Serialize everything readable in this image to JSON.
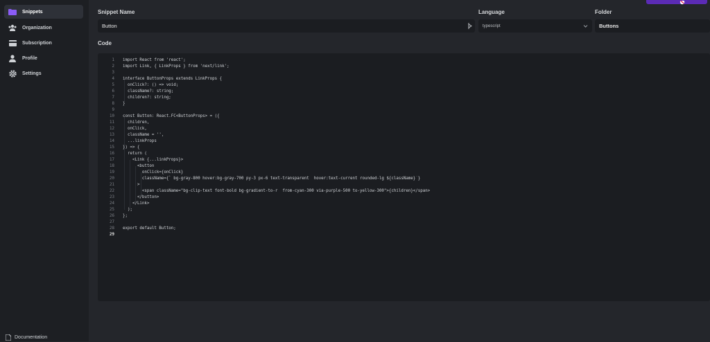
{
  "sidebar": {
    "items": [
      {
        "label": "Snippets",
        "icon": "folder-icon",
        "active": true
      },
      {
        "label": "Organization",
        "icon": "users-icon",
        "active": false
      },
      {
        "label": "Subscription",
        "icon": "credit-card-icon",
        "active": false
      },
      {
        "label": "Profile",
        "icon": "user-icon",
        "active": false
      },
      {
        "label": "Settings",
        "icon": "gear-icon",
        "active": false
      }
    ],
    "footer_link": "Documentation"
  },
  "form": {
    "snippet_name_label": "Snippet Name",
    "snippet_name_value": "Button",
    "language_label": "Language",
    "language_value": "typescript",
    "folder_label": "Folder",
    "folder_value": "Buttons",
    "code_label": "Code"
  },
  "editor": {
    "lines": [
      "import React from 'react';",
      "import Link, { LinkProps } from 'next/link';",
      "",
      "interface ButtonProps extends LinkProps {",
      "  onClick?: () => void;",
      "  className?: string;",
      "  children?: string;",
      "}",
      "",
      "const Button: React.FC<ButtonProps> = ({",
      "  children,",
      "  onClick,",
      "  className = '',",
      "  ...linkProps",
      "}) => {",
      "  return (",
      "    <Link {...linkProps}>",
      "      <button",
      "        onClick={onClick}",
      "        className={` bg-gray-800 hover:bg-gray-700 py-3 px-6 text-transparent  hover:text-current rounded-lg ${className}`}",
      "      >",
      "        <span className=\"bg-clip-text font-bold bg-gradient-to-r  from-cyan-300 via-purple-500 to-yellow-300\">{children}</span>",
      "      </button>",
      "    </Link>",
      "  );",
      "};",
      "",
      "export default Button;",
      ""
    ],
    "current_line": 29
  },
  "colors": {
    "accent": "#5b2bb5",
    "background": "#24262b",
    "sidebar": "#1d1f23",
    "input": "#1b1d21"
  }
}
